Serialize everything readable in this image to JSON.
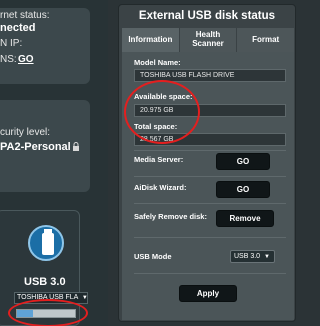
{
  "left": {
    "internet_status_label": "rnet status:",
    "internet_status_value": "nected",
    "wan_ip_label": "N IP:",
    "dns_label": "NS:",
    "dns_link": "GO",
    "security_level_label": "curity level:",
    "security_value": "PA2-Personal",
    "usb_label": "USB 3.0",
    "usb_device_select": "TOSHIBA USB FLA",
    "usb_usage_fraction": 0.27
  },
  "dialog": {
    "title": "External USB disk status",
    "tabs": [
      {
        "label": "Information"
      },
      {
        "label": "Health Scanner"
      },
      {
        "label": "Format"
      }
    ],
    "model_name_label": "Model Name:",
    "model_name_value": "TOSHIBA USB FLASH DRIVE",
    "available_label": "Available space:",
    "available_value": "20.975 GB",
    "total_label": "Total space:",
    "total_value": "28.567 GB",
    "media_server_label": "Media Server:",
    "media_server_button": "GO",
    "aidisk_label": "AiDisk Wizard:",
    "aidisk_button": "GO",
    "safely_remove_label": "Safely Remove disk:",
    "remove_button": "Remove",
    "usb_mode_label": "USB Mode",
    "usb_mode_value": "USB 3.0",
    "apply_button": "Apply"
  },
  "colors": {
    "annotation_red": "#e41f1f",
    "usb_blue": "#1b6ea6"
  }
}
